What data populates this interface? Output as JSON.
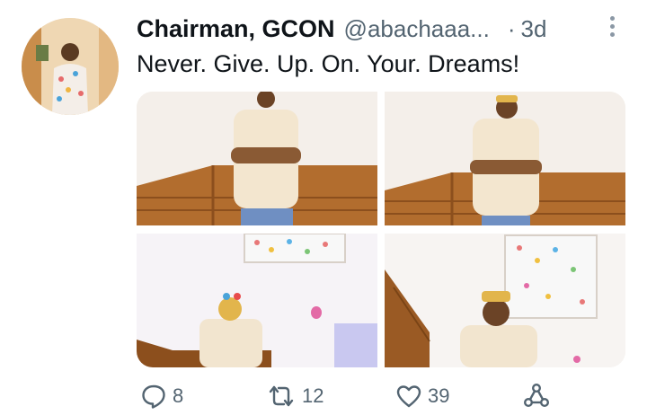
{
  "tweet": {
    "display_name": "Chairman, GCON",
    "handle": "@abachaaa...",
    "separator": "·",
    "time": "3d",
    "text": "Never. Give. Up. On. Your. Dreams!",
    "media": [
      {
        "name": "photo-1"
      },
      {
        "name": "photo-2"
      },
      {
        "name": "photo-3"
      },
      {
        "name": "photo-4"
      }
    ],
    "actions": {
      "reply_count": "8",
      "retweet_count": "12",
      "like_count": "39"
    }
  },
  "icons": {
    "reply": "speech-bubble-icon",
    "retweet": "retweet-arrows-icon",
    "like": "heart-icon",
    "share": "share-nodes-icon",
    "more": "vertical-ellipsis-icon"
  },
  "colors": {
    "text": "#0f1419",
    "muted": "#536471",
    "background": "#ffffff"
  }
}
